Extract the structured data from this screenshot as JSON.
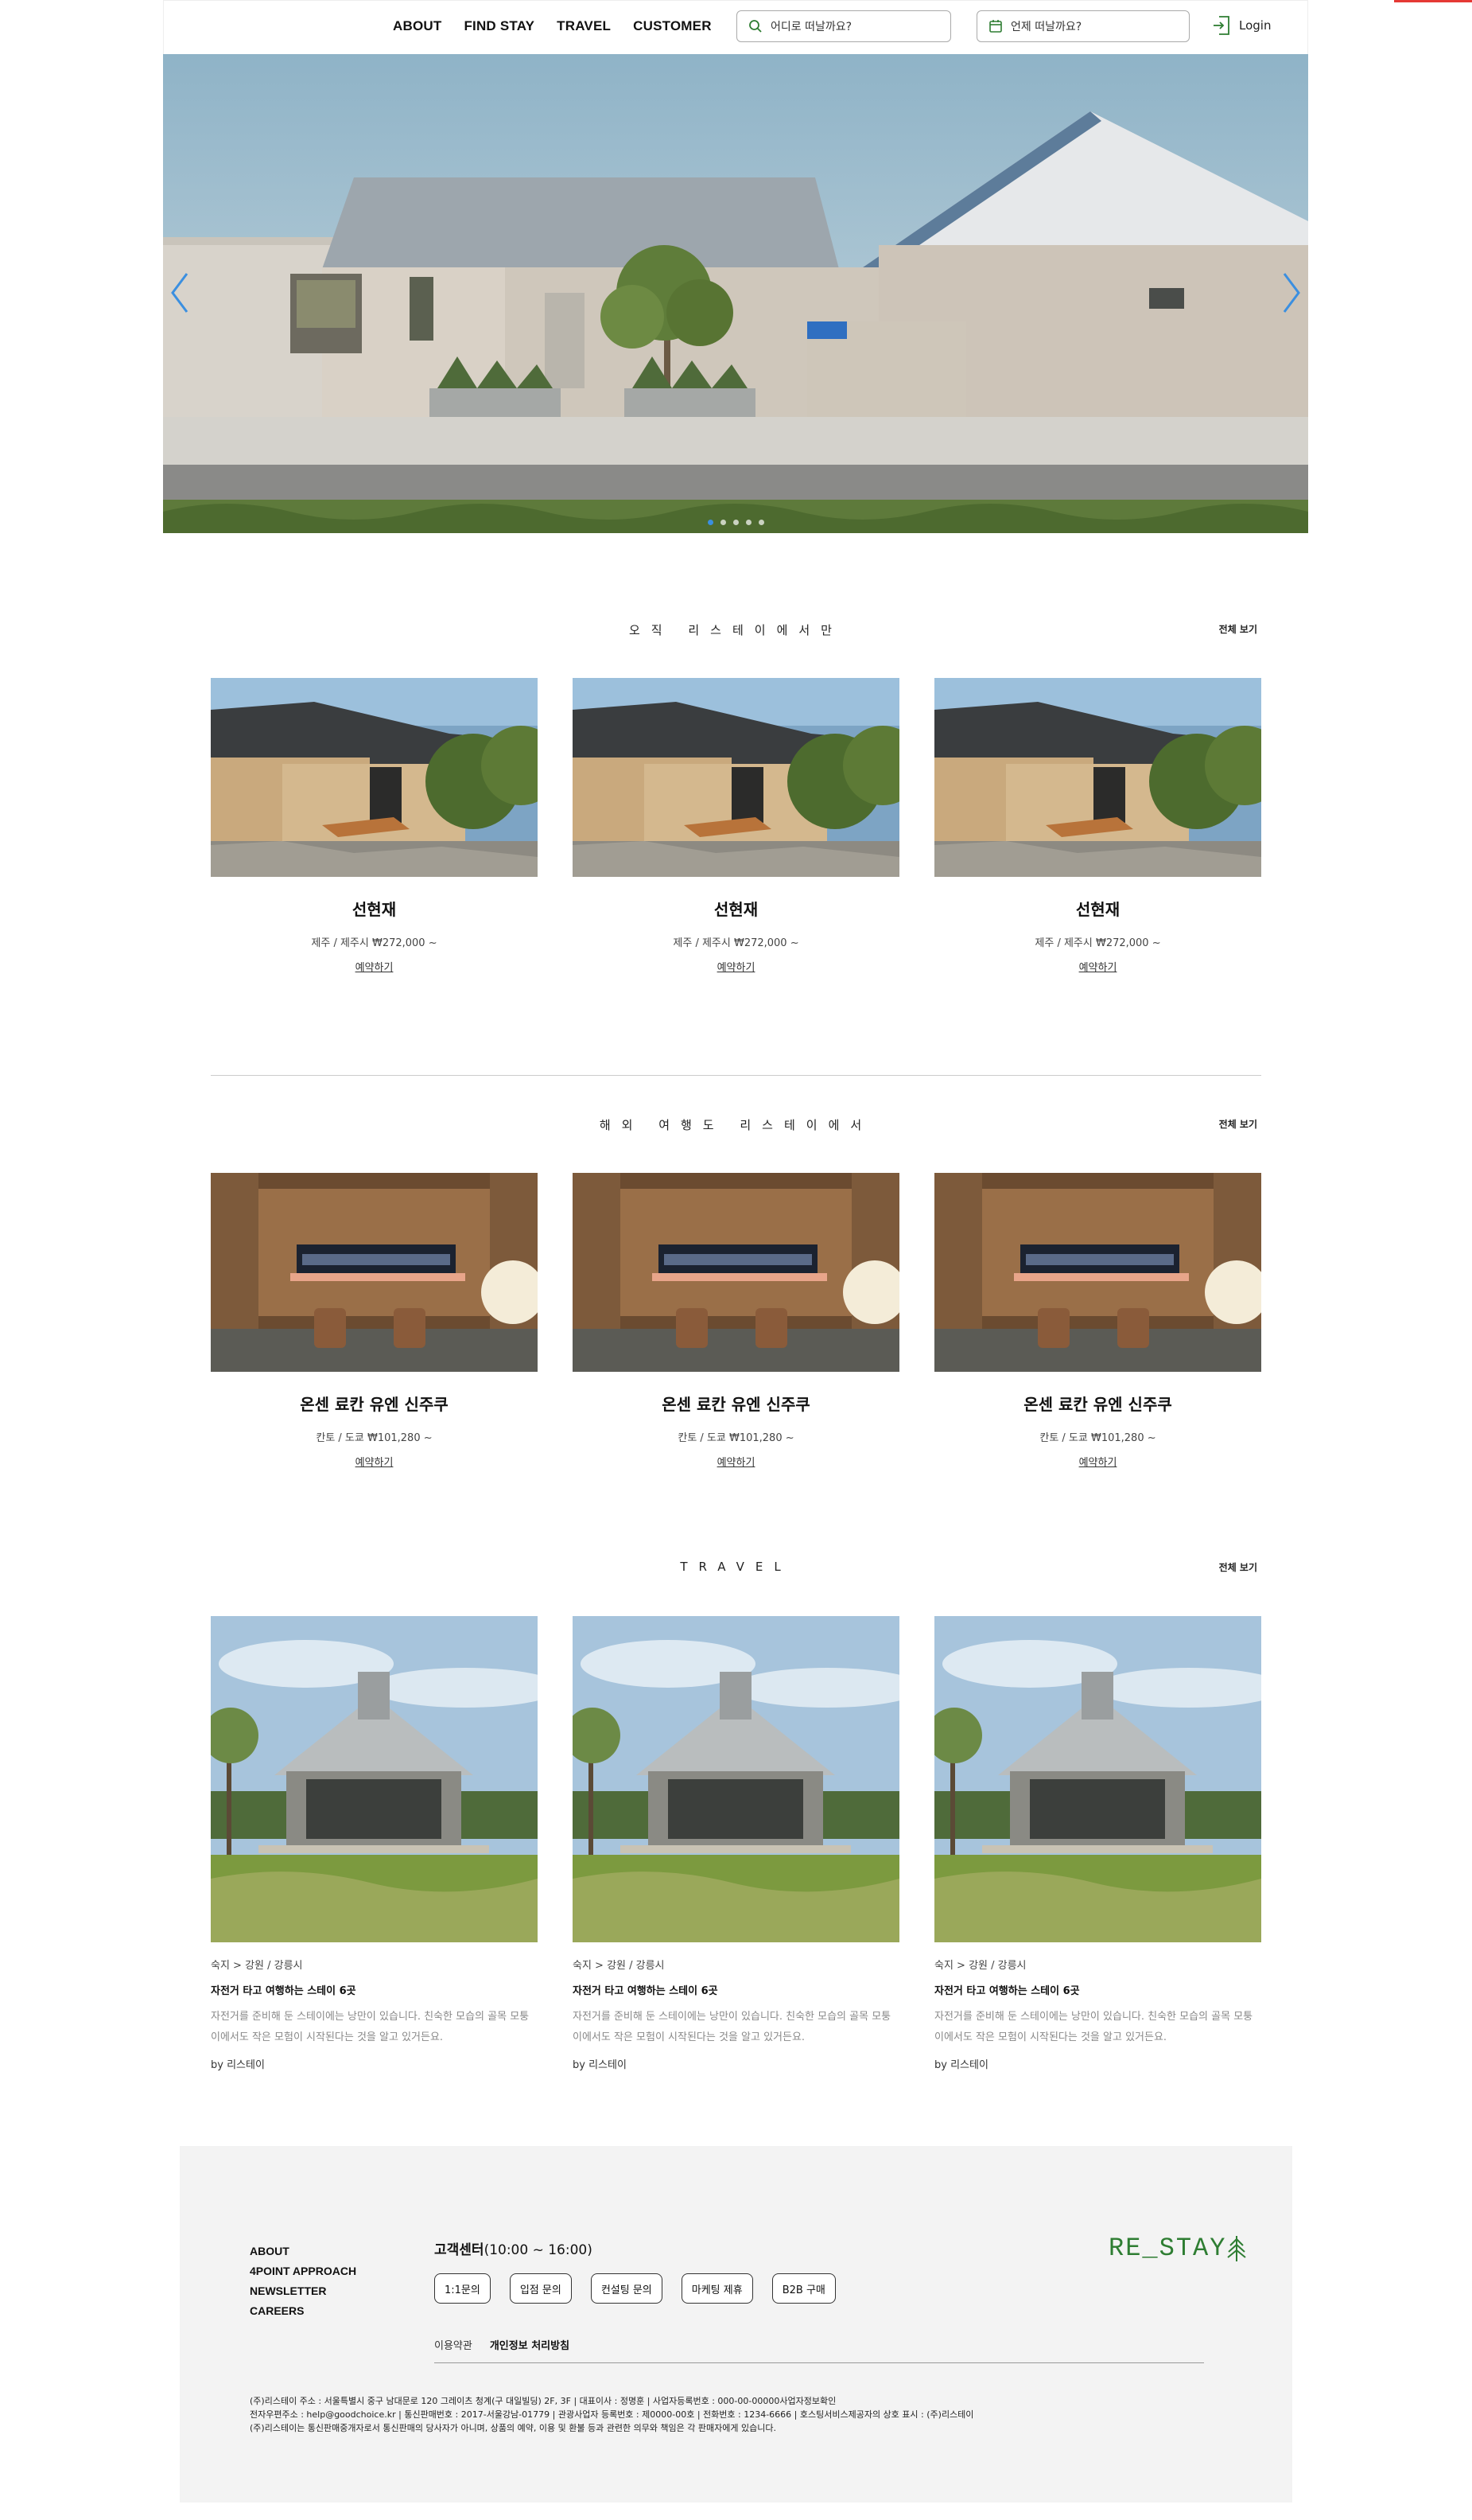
{
  "header": {
    "nav": [
      "ABOUT",
      "FIND STAY",
      "TRAVEL",
      "CUSTOMER"
    ],
    "where_placeholder": "어디로 떠날까요?",
    "when_placeholder": "언제 떠날까요?",
    "login": "Login"
  },
  "hero": {
    "slide_count": 5,
    "active_slide": 1
  },
  "sections": {
    "exclusive": {
      "title": "오직 리스테이에서만",
      "view_all": "전체 보기",
      "cards": [
        {
          "name": "선현재",
          "location": "제주 / 제주시 ₩272,000 ~",
          "book": "예약하기"
        },
        {
          "name": "선현재",
          "location": "제주 / 제주시 ₩272,000 ~",
          "book": "예약하기"
        },
        {
          "name": "선현재",
          "location": "제주 / 제주시 ₩272,000 ~",
          "book": "예약하기"
        }
      ]
    },
    "overseas": {
      "title": "해외 여행도 리스테이에서",
      "view_all": "전체 보기",
      "cards": [
        {
          "name": "온센 료칸 유엔 신주쿠",
          "location": "칸토 / 도쿄 ₩101,280 ~",
          "book": "예약하기"
        },
        {
          "name": "온센 료칸 유엔 신주쿠",
          "location": "칸토 / 도쿄 ₩101,280 ~",
          "book": "예약하기"
        },
        {
          "name": "온센 료칸 유엔 신주쿠",
          "location": "칸토 / 도쿄 ₩101,280 ~",
          "book": "예약하기"
        }
      ]
    },
    "travel": {
      "title": "TRAVEL",
      "view_all": "전체 보기",
      "cards": [
        {
          "location": "숙지 > 강원 / 강릉시",
          "title": "자전거 타고 여행하는 스테이 6곳",
          "desc": "자전거를 준비해 둔 스테이에는 낭만이 있습니다. 친숙한 모습의 골목 모퉁이에서도 작은 모험이 시작된다는 것을 알고 있거든요.",
          "by": "by 리스테이"
        },
        {
          "location": "숙지 > 강원 / 강릉시",
          "title": "자전거 타고 여행하는 스테이 6곳",
          "desc": "자전거를 준비해 둔 스테이에는 낭만이 있습니다. 친숙한 모습의 골목 모퉁이에서도 작은 모험이 시작된다는 것을 알고 있거든요.",
          "by": "by 리스테이"
        },
        {
          "location": "숙지 > 강원 / 강릉시",
          "title": "자전거 타고 여행하는 스테이 6곳",
          "desc": "자전거를 준비해 둔 스테이에는 낭만이 있습니다. 친숙한 모습의 골목 모퉁이에서도 작은 모험이 시작된다는 것을 알고 있거든요.",
          "by": "by 리스테이"
        }
      ]
    }
  },
  "footer": {
    "links": [
      "ABOUT",
      "4POINT APPROACH",
      "NEWSLETTER",
      "CAREERS"
    ],
    "cs_label": "고객센터",
    "cs_hours": "(10:00 ~ 16:00)",
    "cs_buttons": [
      "1:1문의",
      "입점 문의",
      "컨설팅 문의",
      "마케팅 제휴",
      "B2B 구매"
    ],
    "terms": "이용약관",
    "privacy": "개인정보 처리방침",
    "legal": [
      "(주)리스테이 주소 : 서울특별시 중구 남대문로 120 그레이츠 청계(구 대일빌딩) 2F, 3F | 대표이사 : 정명훈 | 사업자등록번호 : 000-00-00000사업자정보확인",
      "전자우편주소 : help@goodchoice.kr | 통신판매번호 : 2017-서울강남-01779 | 관광사업자 등록번호 : 제0000-00호 | 전화번호 : 1234-6666 | 호스팅서비스제공자의 상호 표시 : (주)리스테이",
      "(주)리스테이는 통신판매중개자로서 통신판매의 당사자가 아니며, 상품의 예약, 이용 및 환불 등과 관련한 의무와 책임은 각 판매자에게 있습니다."
    ],
    "logo": "RE_STAY"
  },
  "colors": {
    "accent": "#3b8fe0",
    "logo_green": "#2e7d32",
    "footer_bg": "#f3f3f3"
  }
}
